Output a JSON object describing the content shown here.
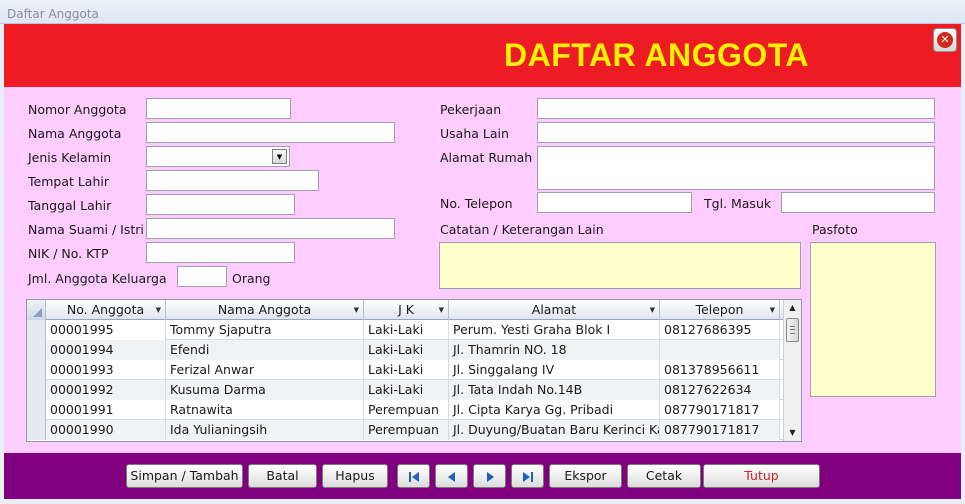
{
  "window": {
    "title": "Daftar Anggota"
  },
  "header": {
    "heading": "DAFTAR ANGGOTA",
    "close_icon": "close-icon",
    "brand_color": "#ed1c24",
    "heading_color": "#fff200"
  },
  "form": {
    "nomor_anggota": {
      "label": "Nomor Anggota",
      "value": ""
    },
    "nama_anggota": {
      "label": "Nama Anggota",
      "value": ""
    },
    "jenis_kelamin": {
      "label": "Jenis Kelamin",
      "value": ""
    },
    "tempat_lahir": {
      "label": "Tempat Lahir",
      "value": ""
    },
    "tanggal_lahir": {
      "label": "Tanggal Lahir",
      "value": ""
    },
    "nama_suami_istri": {
      "label": "Nama Suami / Istri",
      "value": ""
    },
    "nik_ktp": {
      "label": "NIK / No. KTP",
      "value": ""
    },
    "jml_anggota_keluarga": {
      "label": "Jml. Anggota Keluarga",
      "value": "",
      "suffix": "Orang"
    },
    "pekerjaan": {
      "label": "Pekerjaan",
      "value": ""
    },
    "usaha_lain": {
      "label": "Usaha Lain",
      "value": ""
    },
    "alamat_rumah": {
      "label": "Alamat Rumah",
      "value": ""
    },
    "no_telepon": {
      "label": "No. Telepon",
      "value": ""
    },
    "tgl_masuk": {
      "label": "Tgl. Masuk",
      "value": ""
    },
    "catatan": {
      "label": "Catatan / Keterangan Lain",
      "value": ""
    },
    "pasfoto": {
      "label": "Pasfoto"
    }
  },
  "grid": {
    "columns": [
      "No. Anggota",
      "Nama Anggota",
      "J K",
      "Alamat",
      "Telepon"
    ],
    "rows": [
      [
        "00001995",
        "Tommy Sjaputra",
        "Laki-Laki",
        "Perum. Yesti Graha Blok I",
        "08127686395"
      ],
      [
        "00001994",
        "Efendi",
        "Laki-Laki",
        "Jl. Thamrin NO. 18",
        ""
      ],
      [
        "00001993",
        "Ferizal Anwar",
        "Laki-Laki",
        "Jl. Singgalang IV",
        "081378956611"
      ],
      [
        "00001992",
        "Kusuma Darma",
        "Laki-Laki",
        "Jl. Tata Indah No.14B",
        "08127622634"
      ],
      [
        "00001991",
        "Ratnawita",
        "Perempuan",
        "Jl. Cipta Karya Gg. Pribadi",
        "087790171817"
      ],
      [
        "00001990",
        "Ida Yulianingsih",
        "Perempuan",
        "Jl. Duyung/Buatan Baru Kerinci Ka",
        "087790171817"
      ]
    ]
  },
  "footer": {
    "buttons": {
      "simpan": "Simpan / Tambah",
      "batal": "Batal",
      "hapus": "Hapus",
      "ekspor": "Ekspor",
      "cetak": "Cetak",
      "tutup": "Tutup"
    },
    "nav_icons": [
      "first-record-icon",
      "previous-record-icon",
      "next-record-icon",
      "last-record-icon"
    ],
    "bar_color": "#800080"
  },
  "colors": {
    "form_background": "#ffccff",
    "note_background": "#ffffcc"
  }
}
